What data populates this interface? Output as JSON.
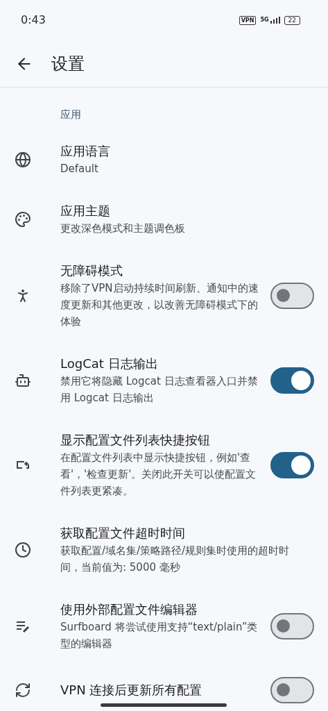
{
  "status_bar": {
    "time": "0:43",
    "vpn": "VPN",
    "network": "5G",
    "battery": "22"
  },
  "header": {
    "title": "设置"
  },
  "section": {
    "title": "应用"
  },
  "items": [
    {
      "title": "应用语言",
      "description": "Default",
      "kind": "plain"
    },
    {
      "title": "应用主题",
      "description": "更改深色模式和主题调色板",
      "kind": "plain"
    },
    {
      "title": "无障碍模式",
      "description": "移除了VPN启动持续时间刷新、通知中的速度更新和其他更改，以改善无障碍模式下的体验",
      "kind": "toggle",
      "on": false
    },
    {
      "title": "LogCat 日志输出",
      "description": "禁用它将隐藏 Logcat 日志查看器入口并禁用 Logcat 日志输出",
      "kind": "toggle",
      "on": true
    },
    {
      "title": "显示配置文件列表快捷按钮",
      "description": "在配置文件列表中显示快捷按钮，例如'查看'，'检查更新'。关闭此开关可以使配置文件列表更紧凑。",
      "kind": "toggle",
      "on": true
    },
    {
      "title": "获取配置文件超时时间",
      "description": "获取配置/域名集/策略路径/规则集时使用的超时时间，当前值为: 5000 毫秒",
      "kind": "plain"
    },
    {
      "title": "使用外部配置文件编辑器",
      "description": "Surfboard 将尝试使用支持“text/plain”类型的编辑器",
      "kind": "toggle",
      "on": false
    },
    {
      "title": "VPN 连接后更新所有配置",
      "kind": "toggle",
      "on": false
    }
  ]
}
